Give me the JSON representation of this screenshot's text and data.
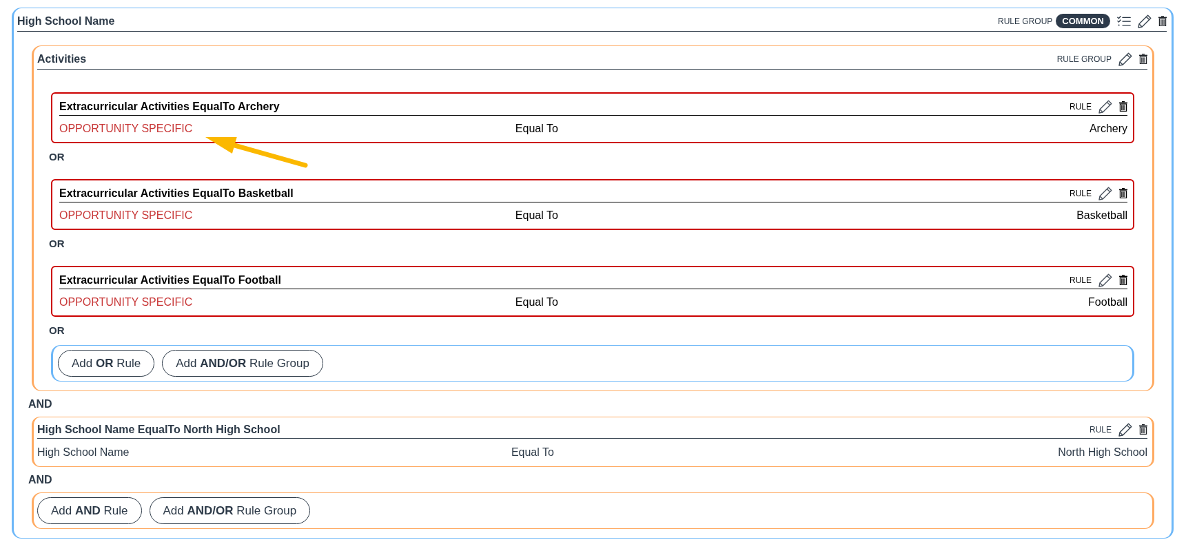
{
  "group": {
    "title": "High School Name",
    "type_label": "RULE GROUP",
    "badge": "COMMON",
    "children": [
      {
        "kind": "group",
        "title": "Activities",
        "type_label": "RULE GROUP",
        "children": [
          {
            "kind": "rule",
            "opportunity_specific": true,
            "title": "Extracurricular Activities EqualTo Archery",
            "type_label": "RULE",
            "field": "OPPORTUNITY SPECIFIC",
            "operator": "Equal To",
            "value": "Archery"
          },
          {
            "kind": "connector",
            "label": "OR"
          },
          {
            "kind": "rule",
            "opportunity_specific": true,
            "title": "Extracurricular Activities EqualTo Basketball",
            "type_label": "RULE",
            "field": "OPPORTUNITY SPECIFIC",
            "operator": "Equal To",
            "value": "Basketball"
          },
          {
            "kind": "connector",
            "label": "OR"
          },
          {
            "kind": "rule",
            "opportunity_specific": true,
            "title": "Extracurricular Activities EqualTo Football",
            "type_label": "RULE",
            "field": "OPPORTUNITY SPECIFIC",
            "operator": "Equal To",
            "value": "Football"
          },
          {
            "kind": "connector",
            "label": "OR"
          },
          {
            "kind": "actions",
            "buttons": [
              "Add **OR** Rule",
              "Add **AND/OR** Rule Group"
            ]
          }
        ]
      },
      {
        "kind": "connector",
        "label": "AND"
      },
      {
        "kind": "rule",
        "opportunity_specific": false,
        "title": "High School Name EqualTo North High School",
        "type_label": "RULE",
        "field": "High School Name",
        "operator": "Equal To",
        "value": "North High School"
      },
      {
        "kind": "connector",
        "label": "AND"
      },
      {
        "kind": "actions",
        "buttons": [
          "Add **AND** Rule",
          "Add **AND/OR** Rule Group"
        ]
      }
    ]
  }
}
